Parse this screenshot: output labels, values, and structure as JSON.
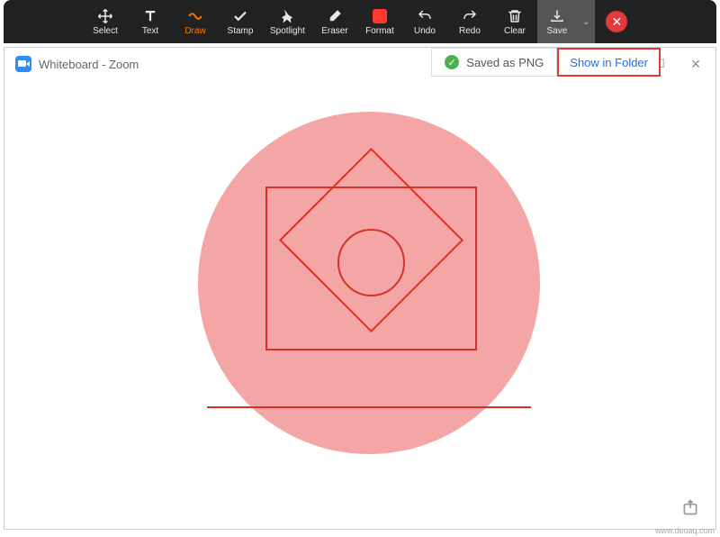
{
  "toolbar": {
    "select": "Select",
    "text": "Text",
    "draw": "Draw",
    "stamp": "Stamp",
    "spotlight": "Spotlight",
    "eraser": "Eraser",
    "format": "Format",
    "undo": "Undo",
    "redo": "Redo",
    "clear": "Clear",
    "save": "Save",
    "format_color": "#ff3b30"
  },
  "notification": {
    "saved_msg": "Saved as PNG",
    "show_folder": "Show in Folder"
  },
  "window": {
    "title": "Whiteboard - Zoom"
  },
  "watermark": "www.deuaq.com"
}
